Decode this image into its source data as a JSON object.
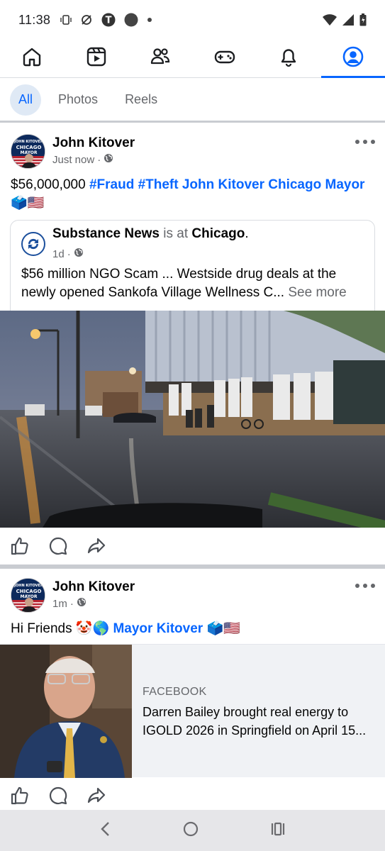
{
  "status_bar": {
    "time": "11:38",
    "left_icons": [
      "vibrate-icon",
      "no-sync-icon",
      "threads-icon",
      "circle-icon",
      "dot-icon"
    ],
    "right_icons": [
      "wifi-icon",
      "signal-icon",
      "battery-icon"
    ]
  },
  "nav": {
    "items": [
      {
        "icon": "home-icon",
        "active": false
      },
      {
        "icon": "video-icon",
        "active": false
      },
      {
        "icon": "friends-icon",
        "active": false
      },
      {
        "icon": "gaming-icon",
        "active": false
      },
      {
        "icon": "bell-icon",
        "active": false
      },
      {
        "icon": "profile-icon",
        "active": true
      }
    ]
  },
  "filters": [
    "All",
    "Photos",
    "Reels"
  ],
  "post1": {
    "author": "John Kitover",
    "time": "Just now",
    "text_plain": "$56,000,000 ",
    "text_tags": "#Fraud #Theft John Kitover Chicago Mayor",
    "text_emoji": "🗳️🇺🇸",
    "shared": {
      "page": "Substance News",
      "is_at": " is at ",
      "place": "Chicago",
      "period": ".",
      "time": "1d",
      "body": "$56 million NGO Scam ... Westside drug deals at the newly opened Sankofa Village Wellness C...",
      "see_more": "See more"
    }
  },
  "post2": {
    "author": "John Kitover",
    "time": "1m",
    "text_plain": "Hi Friends ",
    "text_emoji1": "🤡🌎",
    "text_tag": "Mayor Kitover",
    "text_emoji2": "🗳️🇺🇸",
    "link": {
      "source": "FACEBOOK",
      "title": "Darren Bailey brought real energy to IGOLD 2026 in Springfield on April 15..."
    }
  },
  "avatar_text": {
    "line1": "JOHN KITOVER",
    "line2": "CHICAGO",
    "line3": "MAYOR"
  },
  "colors": {
    "accent": "#0866ff",
    "muted": "#65676b",
    "divider": "#c9ccd1"
  }
}
